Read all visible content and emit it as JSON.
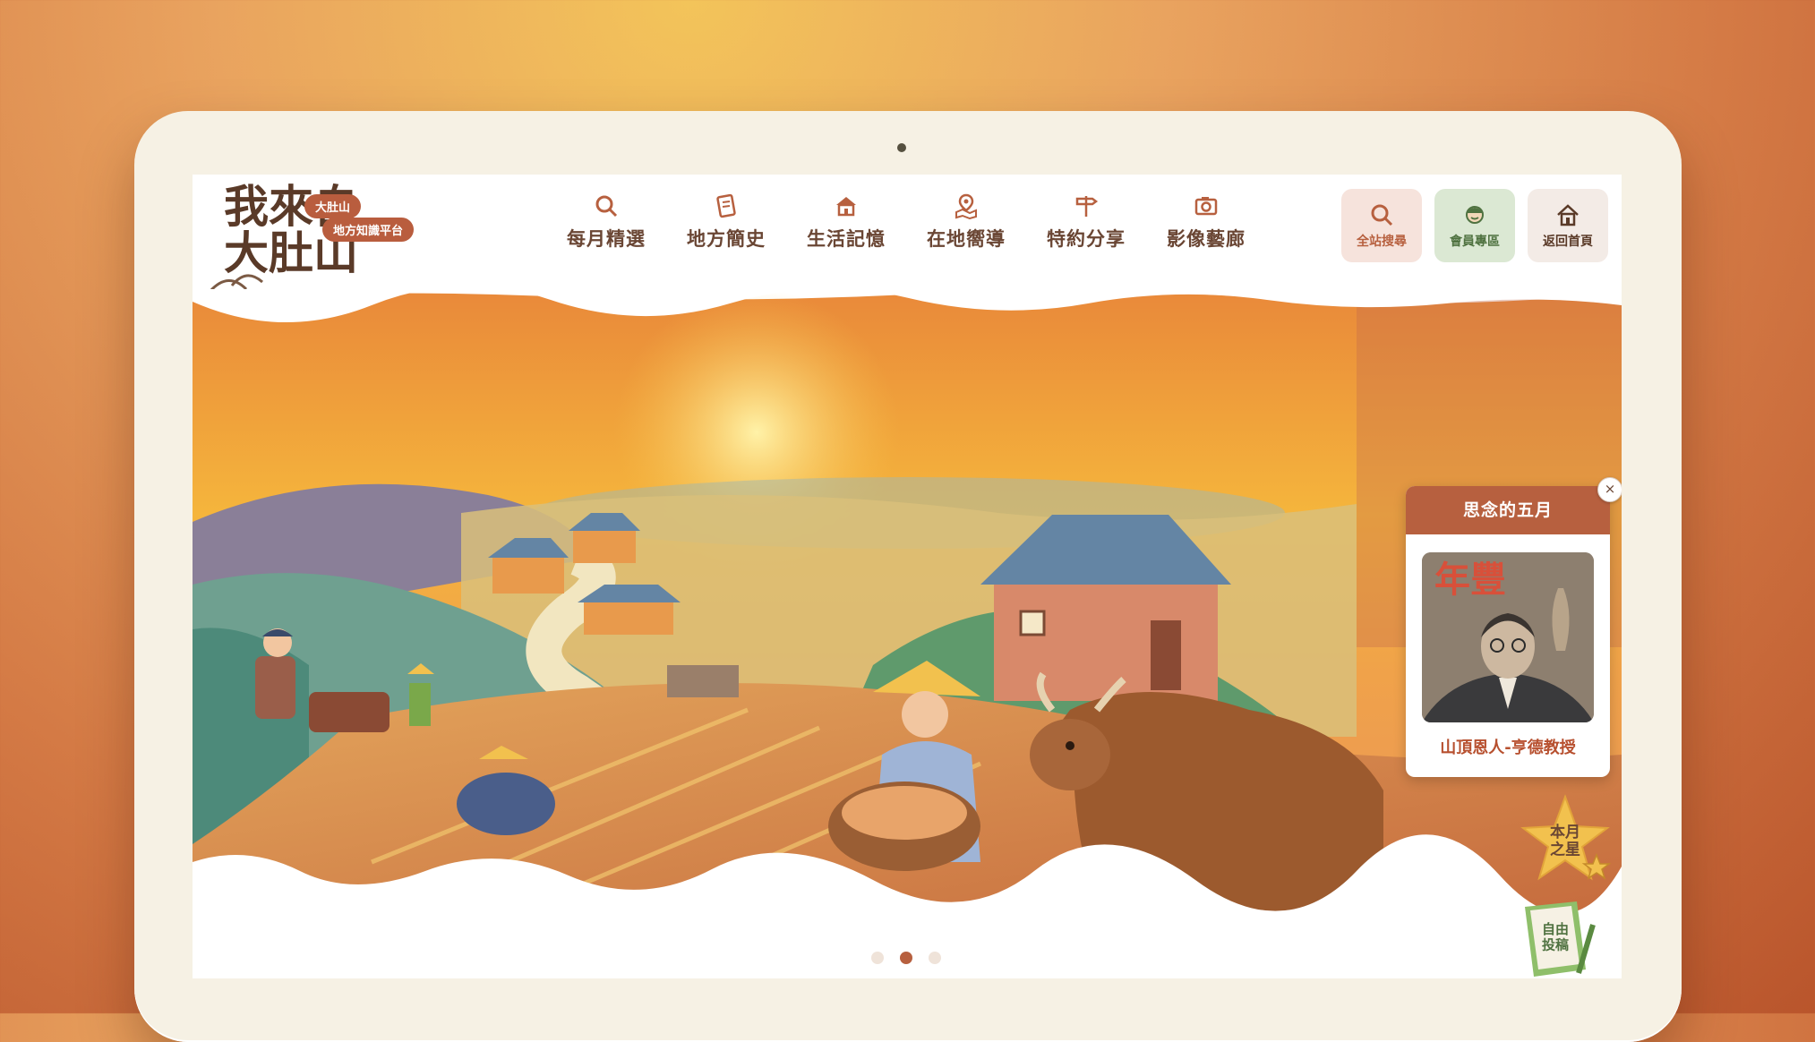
{
  "brand": {
    "logo_text": "我來自大肚山",
    "logo_badge_1": "大肚山",
    "logo_badge_2": "地方知識平台"
  },
  "nav": [
    {
      "label": "每月精選",
      "icon": "search-icon"
    },
    {
      "label": "地方簡史",
      "icon": "document-icon"
    },
    {
      "label": "生活記憶",
      "icon": "house-icon"
    },
    {
      "label": "在地嚮導",
      "icon": "map-pin-icon"
    },
    {
      "label": "特約分享",
      "icon": "signpost-icon"
    },
    {
      "label": "影像藝廊",
      "icon": "camera-icon"
    }
  ],
  "utility": [
    {
      "label": "全站搜尋",
      "icon": "search-icon",
      "bg": "#f6e3dc",
      "fg": "#b7603f"
    },
    {
      "label": "會員專區",
      "icon": "member-icon",
      "bg": "#dbe8d3",
      "fg": "#4f7240"
    },
    {
      "label": "返回首頁",
      "icon": "home-icon",
      "bg": "#f3ebe6",
      "fg": "#5a3a28"
    }
  ],
  "popup": {
    "title": "思念的五月",
    "caption": "山頂恩人-亨德教授",
    "image_text": "年豐",
    "close": "×"
  },
  "star_badge": "本月之星",
  "submit_badge": "自由投稿",
  "carousel": {
    "count": 3,
    "active": 1
  },
  "colors": {
    "accent": "#b7603f",
    "text_brown": "#6a4634",
    "sky": "#f3a43a"
  }
}
